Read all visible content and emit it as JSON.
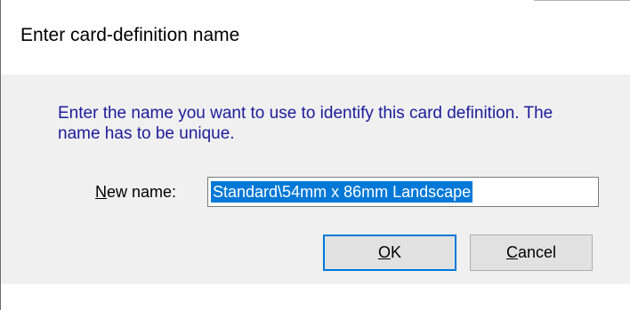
{
  "dialog": {
    "title": "Enter card-definition name",
    "instruction": "Enter the name you want to use to identify this card definition. The name has to be unique.",
    "field_label_access_key": "N",
    "field_label_rest": "ew name:",
    "field_value": "Standard\\54mm x 86mm Landscape",
    "ok_access_key": "O",
    "ok_rest": "K",
    "cancel_access_key": "C",
    "cancel_rest": "ancel"
  },
  "colors": {
    "instruction_text": "#1c1c9c",
    "selection": "#0078d7",
    "default_button_border": "#0078d7",
    "client_background": "#f0f0f0"
  }
}
